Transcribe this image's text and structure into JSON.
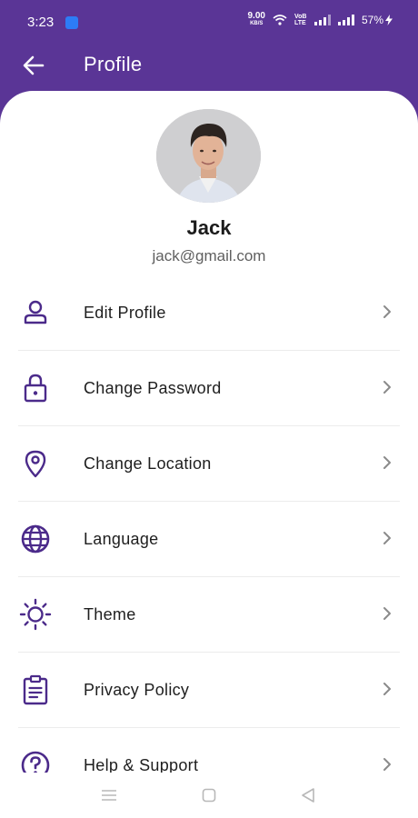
{
  "status": {
    "time": "3:23",
    "net_speed": "9.00",
    "net_speed_unit": "KB/S",
    "volte": "VoB LTE",
    "battery": "57%"
  },
  "header": {
    "title": "Profile",
    "back_icon": "arrow-left-icon"
  },
  "profile": {
    "name": "Jack",
    "email": "jack@gmail.com"
  },
  "menu": {
    "items": [
      {
        "label": "Edit Profile",
        "icon": "person-icon"
      },
      {
        "label": "Change Password",
        "icon": "lock-icon"
      },
      {
        "label": "Change Location",
        "icon": "location-pin-icon"
      },
      {
        "label": "Language",
        "icon": "globe-icon"
      },
      {
        "label": "Theme",
        "icon": "sun-icon"
      },
      {
        "label": "Privacy Policy",
        "icon": "clipboard-icon"
      },
      {
        "label": "Help & Support",
        "icon": "help-circle-icon"
      }
    ]
  },
  "colors": {
    "primary": "#5a3596",
    "icon": "#4b2a8a",
    "chevron": "#8a8a8a"
  }
}
